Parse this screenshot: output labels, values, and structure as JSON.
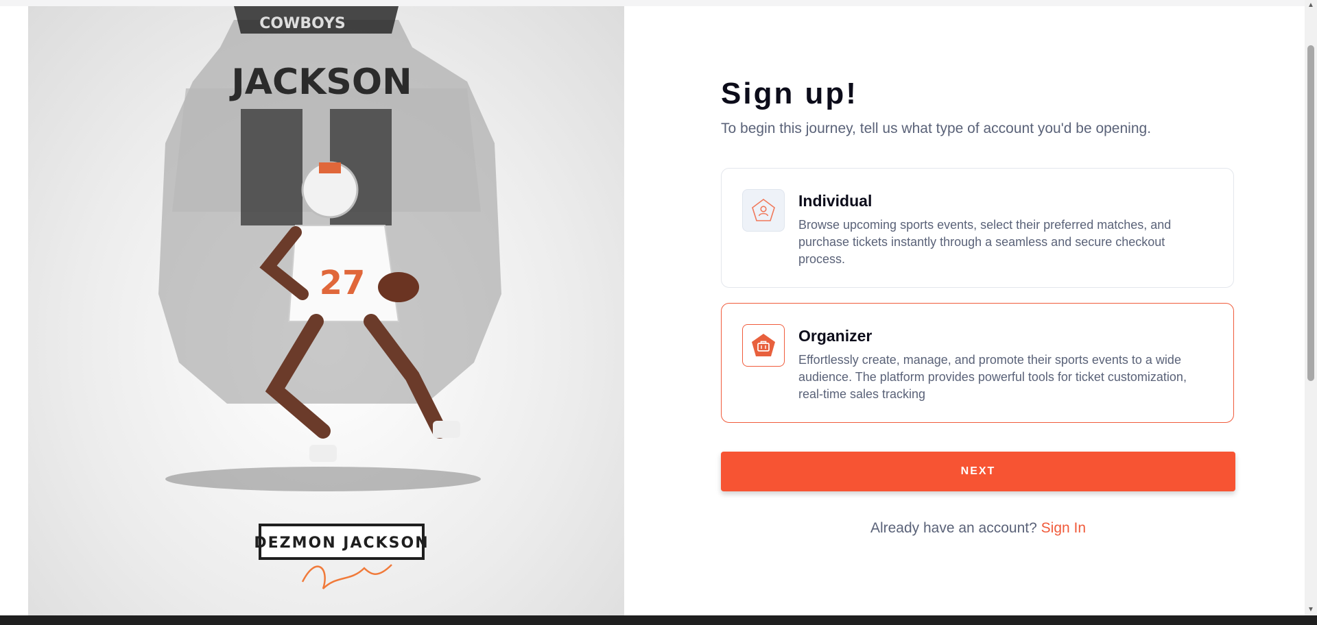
{
  "hero": {
    "jersey_name": "JACKSON",
    "helmet_text": "COWBOYS",
    "jersey_number": "27",
    "player_name_plate": "DEZMON JACKSON",
    "signature_mark": "player-signature"
  },
  "signup": {
    "title": "Sign up!",
    "subtitle": "To begin this journey, tell us what type of account you'd be opening.",
    "options": [
      {
        "title": "Individual",
        "description": "Browse upcoming sports events, select their preferred matches, and purchase tickets instantly through a seamless and secure checkout process.",
        "icon": "user-pentagon-icon",
        "selected": false
      },
      {
        "title": "Organizer",
        "description": "Effortlessly create, manage, and promote their sports events to a wide audience. The platform provides powerful tools for ticket customization, real-time sales tracking",
        "icon": "briefcase-pentagon-icon",
        "selected": true
      }
    ],
    "next_label": "NEXT",
    "signin_prompt": "Already have an account?",
    "signin_link": "Sign In"
  },
  "colors": {
    "accent": "#f75433",
    "title": "#0c0c1a",
    "muted_text": "#5a6278",
    "card_border": "#e3e6ec"
  }
}
